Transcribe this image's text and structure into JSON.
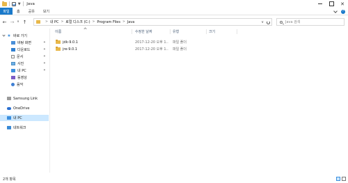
{
  "window": {
    "title": "Java",
    "qa_arrow": "▼",
    "controls": {
      "minimize": "",
      "maximize": "",
      "close": "✕"
    }
  },
  "ribbon": {
    "tabs": [
      "파일",
      "홈",
      "공유",
      "보기"
    ],
    "expand": "",
    "help": "?"
  },
  "nav": {
    "back": "←",
    "forward": "→",
    "recent": "∨",
    "up": "↑"
  },
  "address": {
    "crumbs": [
      "내 PC",
      "로컬 디스크 (C:)",
      "Program Files",
      "Java"
    ],
    "separator": ">",
    "dropdown": "∨"
  },
  "search": {
    "placeholder": "Java 검색"
  },
  "sidebar": {
    "items": [
      {
        "label": "바로 가기",
        "icon": "star-icon",
        "level": 0
      },
      {
        "label": "바탕 화면",
        "icon": "desktop-icon",
        "level": 1,
        "pinned": true
      },
      {
        "label": "다운로드",
        "icon": "download-icon",
        "level": 1,
        "pinned": true
      },
      {
        "label": "문서",
        "icon": "document-icon",
        "level": 1,
        "pinned": true
      },
      {
        "label": "사진",
        "icon": "pictures-icon",
        "level": 1,
        "pinned": true
      },
      {
        "label": "내 PC",
        "icon": "pc-icon",
        "level": 1,
        "pinned": true
      },
      {
        "label": "동영상",
        "icon": "video-icon",
        "level": 1
      },
      {
        "label": "음악",
        "icon": "music-icon",
        "level": 1
      },
      {
        "label": "Samsung Link",
        "icon": "link-icon",
        "level": 0
      },
      {
        "label": "OneDrive",
        "icon": "onedrive-icon",
        "level": 0
      },
      {
        "label": "내 PC",
        "icon": "pc-icon",
        "level": 0,
        "selected": true
      },
      {
        "label": "네트워크",
        "icon": "network-icon",
        "level": 0
      }
    ],
    "pin_glyph": "✦"
  },
  "columns": [
    "이름",
    "수정한 날짜",
    "유형",
    "크기"
  ],
  "files": [
    {
      "name": "jdk-9.0.1",
      "date": "2017-12-20 오후 1...",
      "type": "파일 폴더",
      "size": ""
    },
    {
      "name": "jre-9.0.1",
      "date": "2017-12-20 오후 1...",
      "type": "파일 폴더",
      "size": ""
    }
  ],
  "status": {
    "item_count": "2개 항목"
  },
  "colors": {
    "accent": "#1979ca",
    "selection": "#cce8ff",
    "folder": "#e8b84a",
    "header_text": "#4c607a"
  }
}
